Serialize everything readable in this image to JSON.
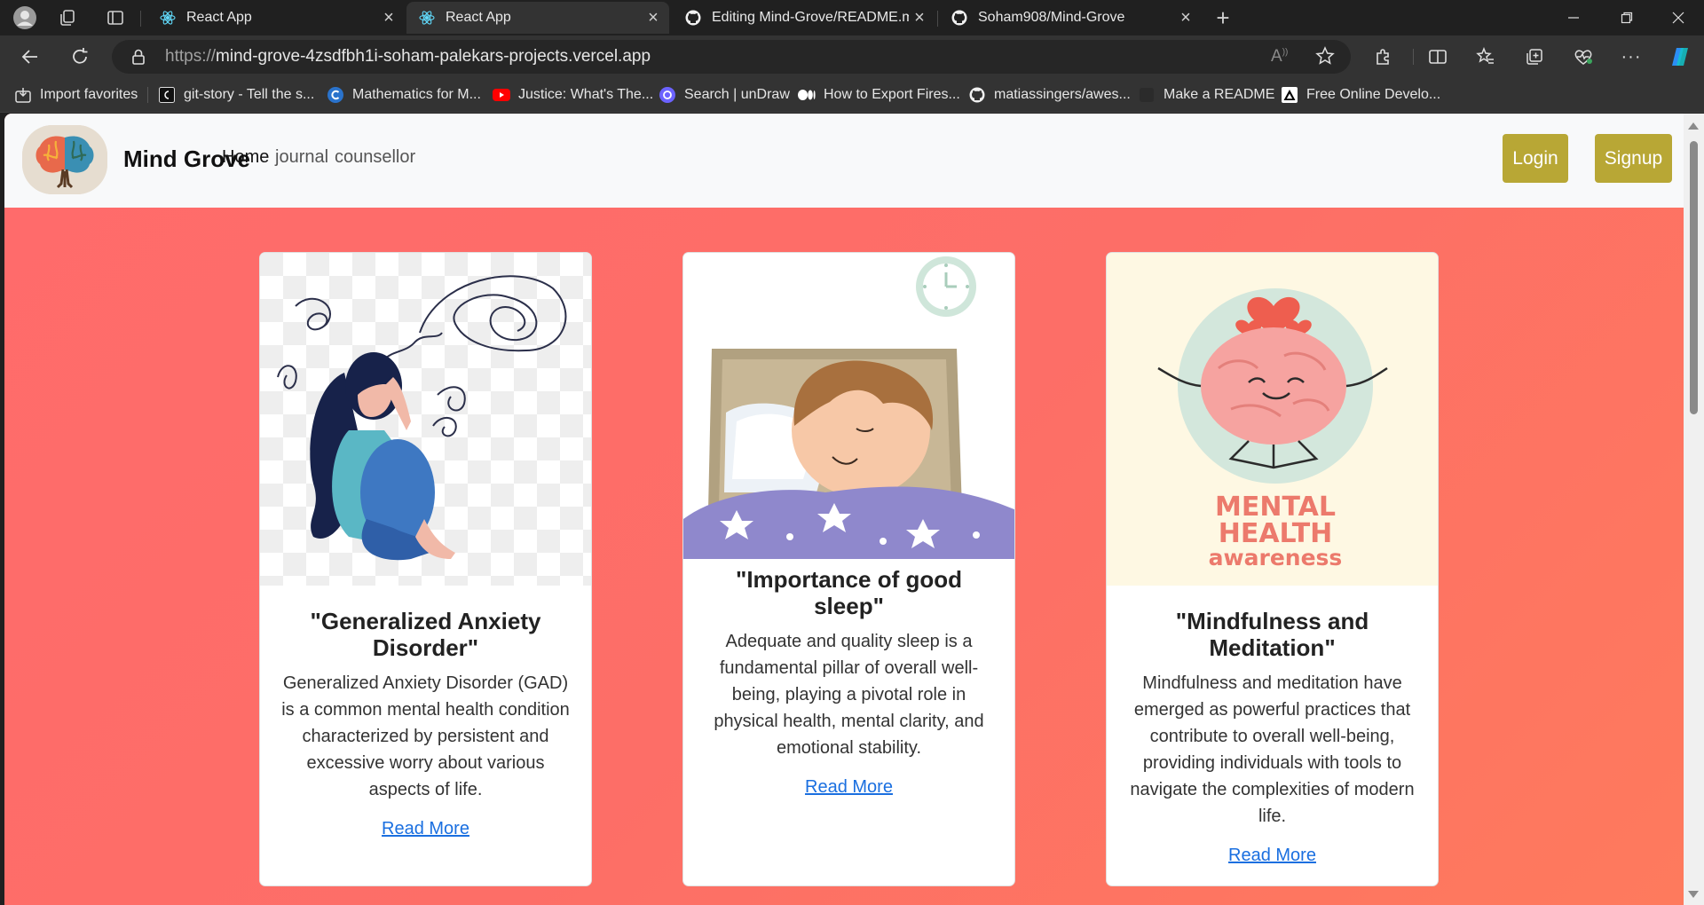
{
  "browser": {
    "tabs": [
      {
        "title": "React App",
        "favicon": "react-icon",
        "active": false
      },
      {
        "title": "React App",
        "favicon": "react-icon",
        "active": true
      },
      {
        "title": "Editing Mind-Grove/README.md",
        "favicon": "github-icon",
        "active": false
      },
      {
        "title": "Soham908/Mind-Grove",
        "favicon": "github-icon",
        "active": false
      }
    ],
    "url_protocol": "https://",
    "url_host": "mind-grove-4zsdfbh1i-soham-palekars-projects.vercel.app",
    "bookmarks": [
      {
        "label": "Import favorites",
        "icon": "import-icon"
      },
      {
        "label": "git-story - Tell the s...",
        "icon": "git-story-icon"
      },
      {
        "label": "Mathematics for M...",
        "icon": "coursera-icon"
      },
      {
        "label": "Justice: What's The...",
        "icon": "youtube-icon"
      },
      {
        "label": "Search | unDraw",
        "icon": "undraw-icon"
      },
      {
        "label": "How to Export Fires...",
        "icon": "medium-icon"
      },
      {
        "label": "matiassingers/awes...",
        "icon": "github-icon"
      },
      {
        "label": "Make a README",
        "icon": "readme-icon"
      },
      {
        "label": "Free Online Develo...",
        "icon": "vercel-icon"
      }
    ]
  },
  "site": {
    "brand": "Mind Grove",
    "nav": [
      {
        "label": "Home",
        "active": true
      },
      {
        "label": "journal",
        "active": false
      },
      {
        "label": "counsellor",
        "active": false
      }
    ],
    "login_label": "Login",
    "signup_label": "Signup",
    "accent_color": "#b8a735",
    "background_color": "#ff6b6b"
  },
  "cards": [
    {
      "image": "anxiety-illustration",
      "title": "\"Generalized Anxiety Disorder\"",
      "text": "Generalized Anxiety Disorder (GAD) is a common mental health condition characterized by persistent and excessive worry about various aspects of life.",
      "link": "Read More"
    },
    {
      "image": "sleep-illustration",
      "title": "\"Importance of good sleep\"",
      "text": "Adequate and quality sleep is a fundamental pillar of overall well-being, playing a pivotal role in physical health, mental clarity, and emotional stability.",
      "link": "Read More"
    },
    {
      "image": "mental-health-illustration",
      "title": "\"Mindfulness and Meditation\"",
      "text": "Mindfulness and meditation have emerged as powerful practices that contribute to overall well-being, providing individuals with tools to navigate the complexities of modern life.",
      "link": "Read More",
      "image_text_1": "MENTAL",
      "image_text_2": "HEALTH",
      "image_text_3": "awareness"
    }
  ]
}
